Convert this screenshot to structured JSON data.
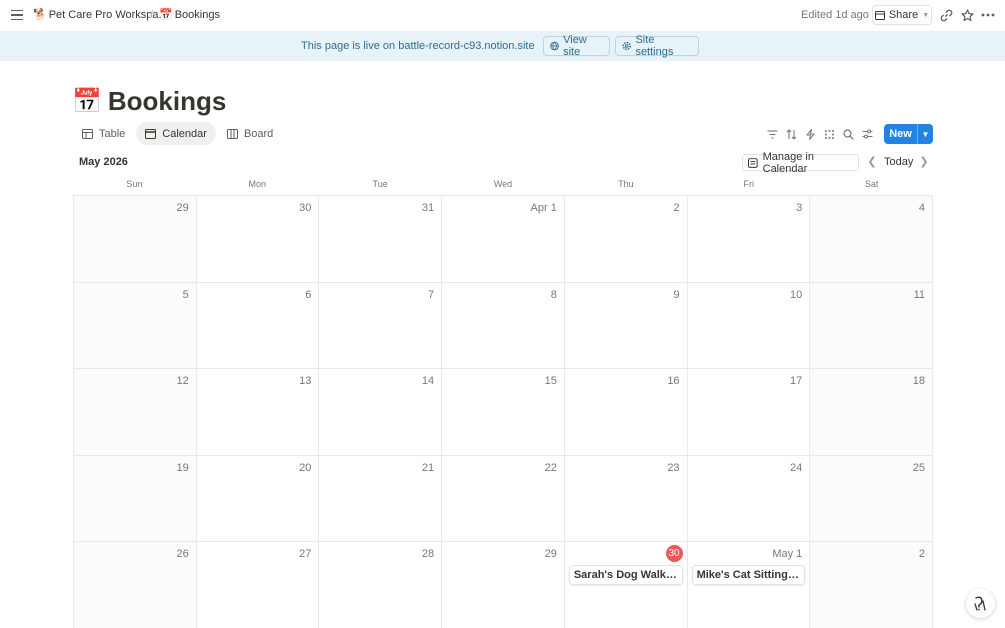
{
  "topbar": {
    "breadcrumb": [
      {
        "emoji": "🐕",
        "label": "Pet Care Pro Workspa..."
      },
      {
        "emoji": "📅",
        "label": "Bookings"
      }
    ],
    "separator": "/",
    "edited": "Edited 1d ago",
    "share_label": "Share"
  },
  "banner": {
    "text": "This page is live on battle-record-c93.notion.site",
    "view_site": "View site",
    "site_settings": "Site settings"
  },
  "page": {
    "emoji": "📅",
    "title": "Bookings"
  },
  "views": {
    "tabs": [
      {
        "label": "Table",
        "icon": "table-icon",
        "active": false
      },
      {
        "label": "Calendar",
        "icon": "calendar-icon",
        "active": true
      },
      {
        "label": "Board",
        "icon": "board-icon",
        "active": false
      }
    ],
    "new_label": "New"
  },
  "calendar": {
    "month": "May 2026",
    "manage_label": "Manage in Calendar",
    "today_label": "Today",
    "weekdays": [
      "Sun",
      "Mon",
      "Tue",
      "Wed",
      "Thu",
      "Fri",
      "Sat"
    ],
    "weeks": [
      [
        "29",
        "30",
        "31",
        "Apr 1",
        "2",
        "3",
        "4"
      ],
      [
        "5",
        "6",
        "7",
        "8",
        "9",
        "10",
        "11"
      ],
      [
        "12",
        "13",
        "14",
        "15",
        "16",
        "17",
        "18"
      ],
      [
        "19",
        "20",
        "21",
        "22",
        "23",
        "24",
        "25"
      ],
      [
        "26",
        "27",
        "28",
        "29",
        "30",
        "May 1",
        "2"
      ]
    ],
    "today_cell": {
      "week": 4,
      "day": 4
    },
    "events": [
      {
        "week": 4,
        "day": 4,
        "title": "Sarah's Dog Walk — ..."
      },
      {
        "week": 4,
        "day": 5,
        "title": "Mike's Cat Sitting — ..."
      }
    ]
  },
  "colors": {
    "accent": "#2383e2",
    "today": "#eb5757",
    "banner_bg": "#e7f3f8",
    "banner_text": "#2c6e8e"
  }
}
